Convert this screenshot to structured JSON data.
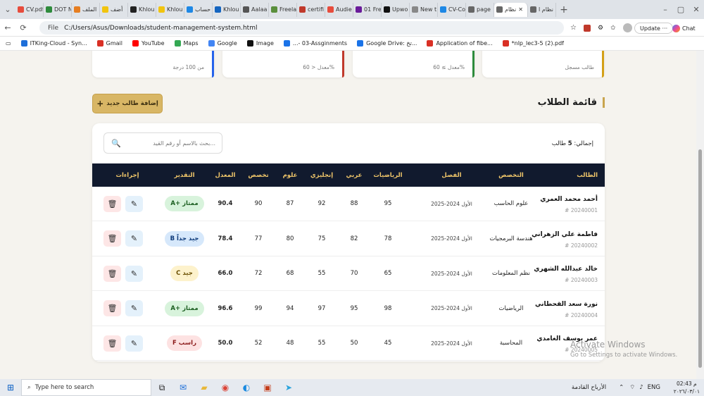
{
  "browser": {
    "tabs": [
      "CV.pdf",
      "DOT N",
      "الملف",
      "أضف",
      "Khlou",
      "Khlou",
      "حساب",
      "Khlou",
      "Aalaa",
      "Freela",
      "certifi",
      "Audie",
      "01 Fre",
      "Upwo",
      "New t",
      "CV-Co",
      "page",
      "نظام",
      "نظام ا"
    ],
    "url_scheme": "File",
    "url": "C:/Users/Asus/Downloads/student-management-system.html",
    "update_label": "Update",
    "chat_label": "Chat",
    "bookmarks": [
      "ITKing-Cloud - Syn...",
      "Gmail",
      "YouTube",
      "Maps",
      "Google",
      "Image",
      "...- 03-Assginments",
      "Google Drive: تخ...",
      "Application of fibe...",
      "*nlp_lec3-5 (2).pdf"
    ]
  },
  "stats": [
    {
      "label": "طالب مسجل",
      "color": "#d4a017"
    },
    {
      "label": "معدل ≥ 60%",
      "color": "#2e8b3c"
    },
    {
      "label": "معدل < 60%",
      "color": "#c0392b"
    },
    {
      "label": "من 100 درجة",
      "color": "#2563eb"
    }
  ],
  "section": {
    "title": "قائمة الطلاب",
    "add_button": "إضافة طالب جديد",
    "add_icon": "+"
  },
  "toolbar": {
    "search_placeholder": "بحث بالاسم أو رقم القيد...",
    "total_prefix": "إجمالي:",
    "total_count": "5",
    "total_suffix": "طالب"
  },
  "table": {
    "headers": {
      "name": "الطالب",
      "major": "التخصص",
      "semester": "الفصل",
      "math": "الرياضيات",
      "arabic": "عربي",
      "english": "إنجليزي",
      "science": "علوم",
      "specialty": "تخصص",
      "average": "المعدل",
      "grade": "التقدير",
      "actions": "إجراءات"
    },
    "rows": [
      {
        "name": "أحمد محمد العمري",
        "id": "# 20240001",
        "major": "علوم الحاسب",
        "semester": "الأول 2024-2025",
        "math": "95",
        "arabic": "88",
        "english": "92",
        "science": "87",
        "specialty": "90",
        "average": "90.4",
        "grade": "A+ ممتاز",
        "grade_bg": "#d8f3dc",
        "grade_fg": "#1b5e20"
      },
      {
        "name": "فاطمة علي الزهراني",
        "id": "# 20240002",
        "major": "هندسة البرمجيات",
        "semester": "الأول 2024-2025",
        "math": "78",
        "arabic": "82",
        "english": "75",
        "science": "80",
        "specialty": "77",
        "average": "78.4",
        "grade": "B جيد جداً",
        "grade_bg": "#d6e8fb",
        "grade_fg": "#0d3a7a"
      },
      {
        "name": "خالد عبدالله الشهري",
        "id": "# 20240003",
        "major": "نظم المعلومات",
        "semester": "الأول 2024-2025",
        "math": "65",
        "arabic": "70",
        "english": "55",
        "science": "68",
        "specialty": "72",
        "average": "66.0",
        "grade": "C جيد",
        "grade_bg": "#fdf2cc",
        "grade_fg": "#6b4f00"
      },
      {
        "name": "نورة سعد القحطاني",
        "id": "# 20240004",
        "major": "الرياضيات",
        "semester": "الأول 2024-2025",
        "math": "98",
        "arabic": "95",
        "english": "97",
        "science": "94",
        "specialty": "99",
        "average": "96.6",
        "grade": "A+ ممتاز",
        "grade_bg": "#d8f3dc",
        "grade_fg": "#1b5e20"
      },
      {
        "name": "عمر يوسف الغامدي",
        "id": "# 20240005",
        "major": "المحاسبة",
        "semester": "الأول 2024-2025",
        "math": "45",
        "arabic": "50",
        "english": "55",
        "science": "48",
        "specialty": "52",
        "average": "50.0",
        "grade": "F راسب",
        "grade_bg": "#fde2e2",
        "grade_fg": "#8b1a1a"
      }
    ]
  },
  "watermark": {
    "line1": "Activate Windows",
    "line2": "Go to Settings to activate Windows."
  },
  "taskbar": {
    "search_placeholder": "Type here to search",
    "weather": "الأرباح القادمة",
    "lang": "ENG",
    "time": "02:43 م",
    "date": "٢٠٢٦/٠٣/٠١"
  }
}
